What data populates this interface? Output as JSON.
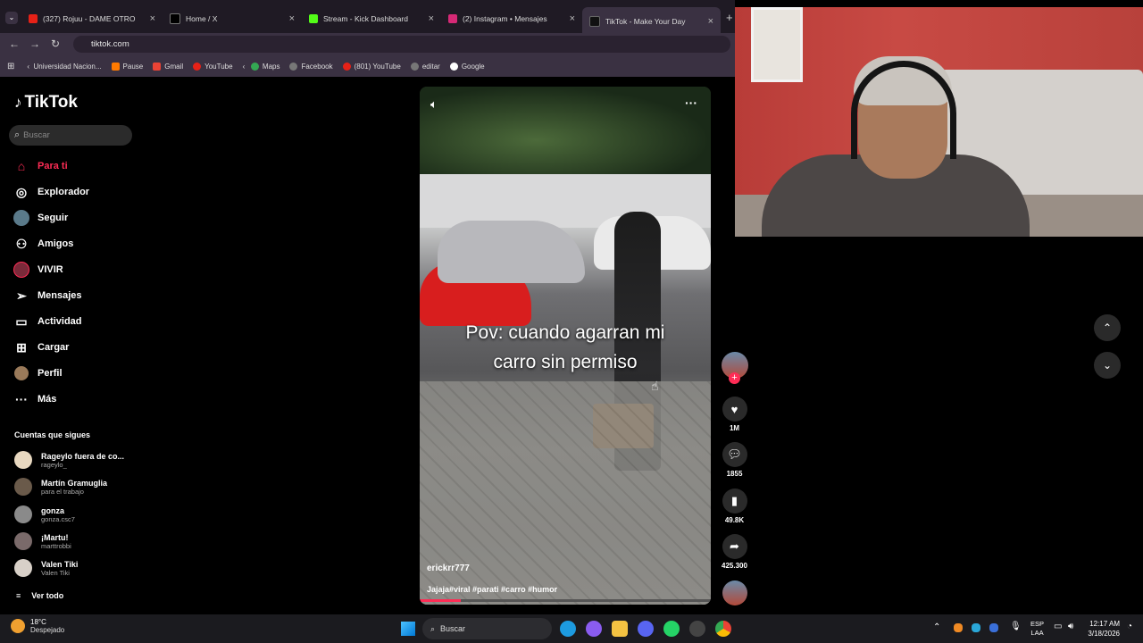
{
  "browser": {
    "tabs": [
      {
        "title": "(327) Rojuu - DAME OTRO",
        "color": "#e62117"
      },
      {
        "title": "Home / X",
        "color": "#ffffff"
      },
      {
        "title": "Stream - Kick Dashboard",
        "color": "#53fc18"
      },
      {
        "title": "(2) Instagram • Mensajes",
        "color": "#d62976"
      },
      {
        "title": "TikTok - Make Your Day",
        "color": "#ffffff"
      }
    ],
    "url": "tiktok.com",
    "bookmarks": [
      "Universidad Nacion...",
      "Pause",
      "Gmail",
      "YouTube",
      "Maps",
      "Facebook",
      "(801) YouTube",
      "editar",
      "Google"
    ]
  },
  "sidebar": {
    "logo": "TikTok",
    "search_placeholder": "Buscar",
    "nav": [
      {
        "label": "Para ti",
        "icon": "home-icon"
      },
      {
        "label": "Explorador",
        "icon": "compass-icon"
      },
      {
        "label": "Seguir",
        "icon": "following-icon"
      },
      {
        "label": "Amigos",
        "icon": "friends-icon"
      },
      {
        "label": "VIVIR",
        "icon": "live-icon"
      },
      {
        "label": "Mensajes",
        "icon": "send-icon"
      },
      {
        "label": "Actividad",
        "icon": "activity-icon"
      },
      {
        "label": "Cargar",
        "icon": "upload-icon"
      },
      {
        "label": "Perfil",
        "icon": "profile-icon"
      },
      {
        "label": "Más",
        "icon": "more-icon"
      }
    ],
    "following_title": "Cuentas que sigues",
    "accounts": [
      {
        "name": "Rageylo fuera de co...",
        "handle": "rageylo_"
      },
      {
        "name": "Martín Gramuglia",
        "handle": "para el trabajo"
      },
      {
        "name": "gonza",
        "handle": "gonza.csc7"
      },
      {
        "name": "¡Martu!",
        "handle": "marttrobbi"
      },
      {
        "name": "Valen Tiki",
        "handle": "Valen Tiki"
      }
    ],
    "see_all": "Ver todo"
  },
  "video": {
    "caption_line1": "Pov: cuando agarran mi",
    "caption_line2": "carro sin permiso",
    "username": "erickrr777",
    "hashtags": "Jajaja#viral #parati #carro #humor",
    "likes": "1M",
    "comments": "1855",
    "saves": "49.8K",
    "shares": "425.300"
  },
  "taskbar": {
    "weather_temp": "18°C",
    "weather_desc": "Despejado",
    "search": "Buscar",
    "lang_top": "ESP",
    "lang_bottom": "LAA",
    "time": "12:17 AM",
    "date": "3/18/2026"
  },
  "colors": {
    "accent": "#fe2c55"
  }
}
